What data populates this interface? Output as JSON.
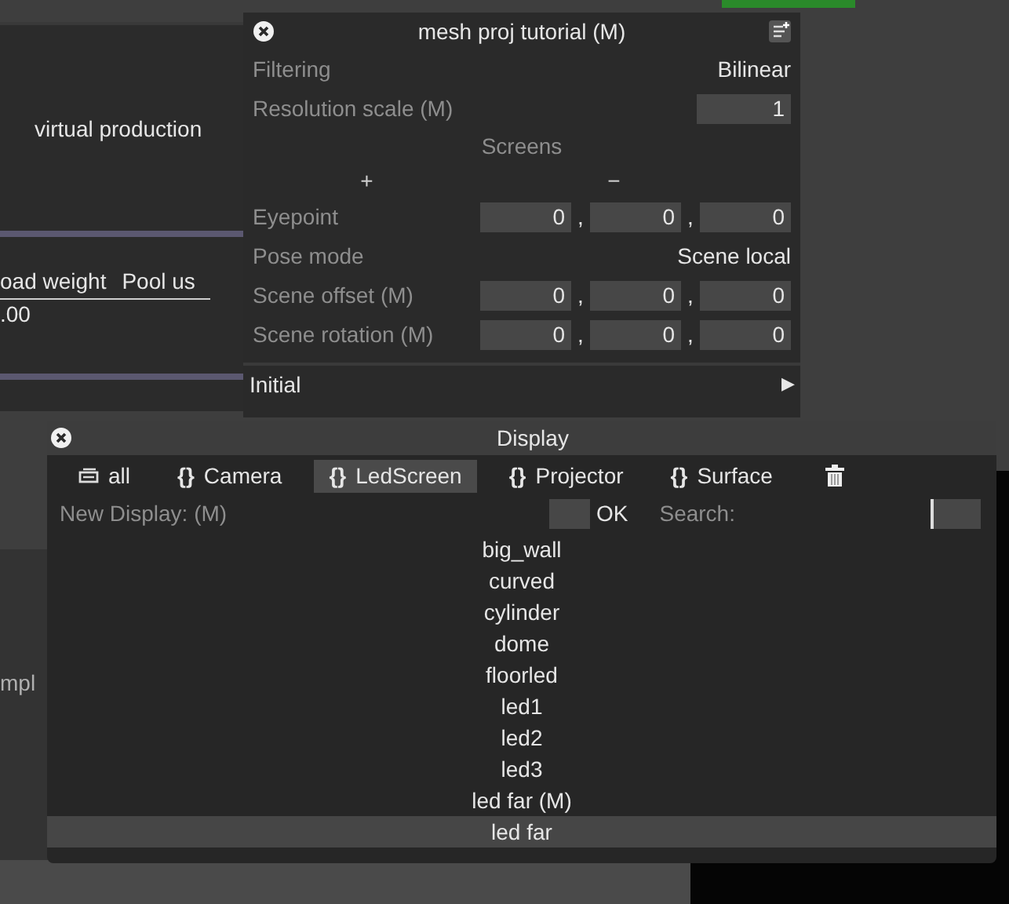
{
  "background": {
    "heading": "virtual production",
    "columns": [
      "oad weight",
      "Pool us"
    ],
    "value": ".00",
    "side_label": "mpl"
  },
  "mesh_window": {
    "title": "mesh proj tutorial (M)",
    "rows": [
      {
        "kind": "value",
        "label": "Filtering",
        "value": "Bilinear"
      },
      {
        "kind": "field",
        "label": "Resolution scale (M)",
        "value": "1"
      },
      {
        "kind": "section",
        "label": "Screens"
      },
      {
        "kind": "add_remove",
        "add": "+",
        "remove": "−"
      },
      {
        "kind": "vector",
        "label": "Eyepoint",
        "values": [
          "0",
          "0",
          "0"
        ]
      },
      {
        "kind": "value",
        "label": "Pose mode",
        "value": "Scene local"
      },
      {
        "kind": "vector",
        "label": "Scene offset (M)",
        "values": [
          "0",
          "0",
          "0"
        ]
      },
      {
        "kind": "vector",
        "label": "Scene rotation (M)",
        "values": [
          "0",
          "0",
          "0"
        ]
      }
    ],
    "separator": ",",
    "footer": {
      "label": "Initial",
      "arrow": "▶"
    }
  },
  "display_window": {
    "title": "Display",
    "tabs": [
      {
        "kind": "all",
        "label": "all",
        "selected": false
      },
      {
        "kind": "type",
        "glyph": "{}",
        "label": "Camera",
        "selected": false
      },
      {
        "kind": "type",
        "glyph": "{}",
        "label": "LedScreen",
        "selected": true
      },
      {
        "kind": "type",
        "glyph": "{}",
        "label": "Projector",
        "selected": false
      },
      {
        "kind": "type",
        "glyph": "{}",
        "label": "Surface",
        "selected": false
      }
    ],
    "new_display_label": "New Display: (M)",
    "ok": "OK",
    "search_label": "Search:",
    "items": [
      {
        "label": "big_wall",
        "selected": false
      },
      {
        "label": "curved",
        "selected": false
      },
      {
        "label": "cylinder",
        "selected": false
      },
      {
        "label": "dome",
        "selected": false
      },
      {
        "label": "floorled",
        "selected": false
      },
      {
        "label": "led1",
        "selected": false
      },
      {
        "label": "led2",
        "selected": false
      },
      {
        "label": "led3",
        "selected": false
      },
      {
        "label": "led far (M)",
        "selected": false
      },
      {
        "label": "led far",
        "selected": true
      }
    ]
  }
}
